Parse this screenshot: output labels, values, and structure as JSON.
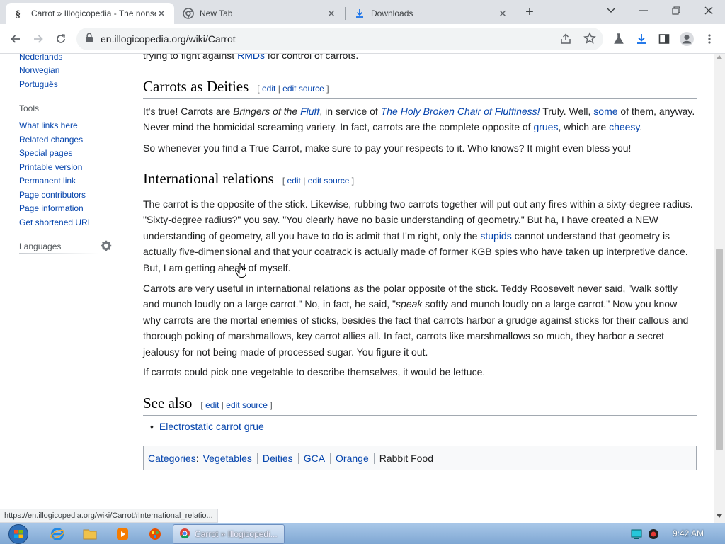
{
  "browser": {
    "tabs": [
      {
        "title": "Carrot » Illogicopedia - The nonsensical encyclopedia",
        "favicon": "illogicopedia-logo-icon"
      },
      {
        "title": "New Tab",
        "favicon": "chrome-icon"
      },
      {
        "title": "Downloads",
        "favicon": "download-icon"
      }
    ],
    "url": "en.illogicopedia.org/wiki/Carrot",
    "status_url": "https://en.illogicopedia.org/wiki/Carrot#International_relatio..."
  },
  "sidebar": {
    "languages_top": [
      "Nederlands",
      "Norwegian",
      "Português"
    ],
    "tools_heading": "Tools",
    "tools": [
      "What links here",
      "Related changes",
      "Special pages",
      "Printable version",
      "Permanent link",
      "Page contributors",
      "Page information",
      "Get shortened URL"
    ],
    "languages_heading": "Languages"
  },
  "article": {
    "top_fragment": {
      "pre": "trying to fight against ",
      "link": "RMDs",
      "post": " for control of carrots."
    },
    "edit_open": "[",
    "edit": "edit",
    "edit_sep": "|",
    "edit_source": "edit source",
    "edit_close": "]",
    "deities": {
      "heading": "Carrots as Deities",
      "p1": {
        "a": "It's true! Carrots are ",
        "b_italic": "Bringers of the ",
        "c_link_italic": "Fluff",
        "d": ", in service of ",
        "e_link_italic": "The Holy Broken Chair of Fluffiness!",
        "f": " Truly. Well, ",
        "g_link": "some",
        "h": " of them, anyway. Never mind the homicidal screaming variety. In fact, carrots are the complete opposite of ",
        "i_link": "grues",
        "j": ", which are ",
        "k_link": "cheesy",
        "l": "."
      },
      "p2": "So whenever you find a True Carrot, make sure to pay your respects to it. Who knows? It might even bless you!"
    },
    "intl": {
      "heading": "International relations",
      "p1": {
        "a": "The carrot is the opposite of the stick. Likewise, rubbing two carrots together will put out any fires within a sixty-degree radius. \"Sixty-degree radius?\" you say. \"You clearly have no basic understanding of geometry.\" But ha, I have created a NEW understanding of geometry, all you have to do is admit that I'm right, only the ",
        "b_link": "stupids",
        "c": " cannot understand that geometry is actually five-dimensional and that your coatrack is actually made of former KGB spies who have taken up interpretive dance. But, I am getting ahead of myself."
      },
      "p2": {
        "a": "Carrots are very useful in international relations as the polar opposite of the stick. Teddy Roosevelt never said, \"walk softly and munch loudly on a large carrot.\" No, in fact, he said, \"",
        "b_italic": "speak",
        "c": " softly and munch loudly on a large carrot.\" Now you know why carrots are the mortal enemies of sticks, besides the fact that carrots harbor a grudge against sticks for their callous and thorough poking of marshmallows, key carrot allies all. In fact, carrots like marshmallows so much, they harbor a secret jealousy for not being made of processed sugar. You figure it out."
      },
      "p3": "If carrots could pick one vegetable to describe themselves, it would be lettuce."
    },
    "see_also": {
      "heading": "See also",
      "items": [
        "Electrostatic carrot grue"
      ]
    },
    "categories": {
      "label": "Categories",
      "colon": ":",
      "items": [
        "Vegetables",
        "Deities",
        "GCA",
        "Orange",
        "Rabbit Food"
      ]
    }
  },
  "taskbar": {
    "task_title": "Carrot » Illogicopedi...",
    "clock": "9:42 AM"
  },
  "colors": {
    "link": "#0645ad",
    "content_border": "#a7d7f9",
    "taskbar": "#7fa7d3"
  }
}
